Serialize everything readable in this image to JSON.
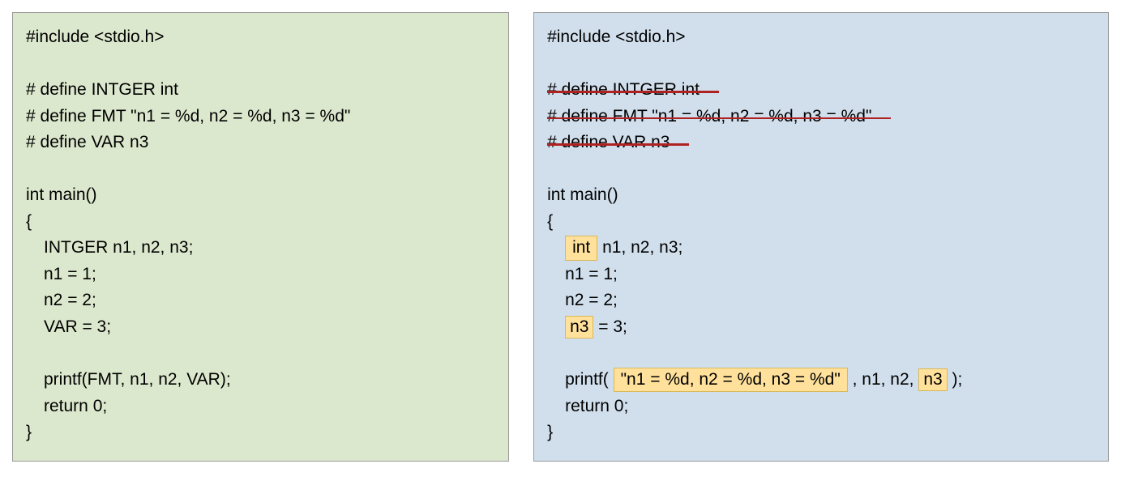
{
  "left": {
    "l1": "#include <stdio.h>",
    "l3": "# define INTGER int",
    "l4": "# define FMT \"n1 = %d, n2 = %d, n3 = %d\"",
    "l5": "# define VAR n3",
    "l7": "int main()",
    "l8": "{",
    "l9": "INTGER n1, n2, n3;",
    "l10": "n1 = 1;",
    "l11": "n2 = 2;",
    "l12": "VAR = 3;",
    "l14": "printf(FMT, n1, n2, VAR);",
    "l15": "return 0;",
    "l16": "}"
  },
  "right": {
    "l1": "#include <stdio.h>",
    "l3": "# define INTGER int",
    "l4": "# define FMT \"n1 = %d, n2 = %d, n3 = %d\"",
    "l5": "# define VAR n3",
    "l7": "int main()",
    "l8": "{",
    "hl_int": "int",
    "l9_rest": " n1, n2, n3;",
    "l10": "n1 = 1;",
    "l11": "n2 = 2;",
    "hl_n3_a": "n3",
    "l12_rest": " = 3;",
    "l14_pre": "printf( ",
    "hl_fmt": "\"n1 = %d, n2 = %d, n3 = %d\"",
    "l14_mid": " , n1, n2, ",
    "hl_n3_b": "n3",
    "l14_post": " );",
    "l15": "return 0;",
    "l16": "}"
  }
}
